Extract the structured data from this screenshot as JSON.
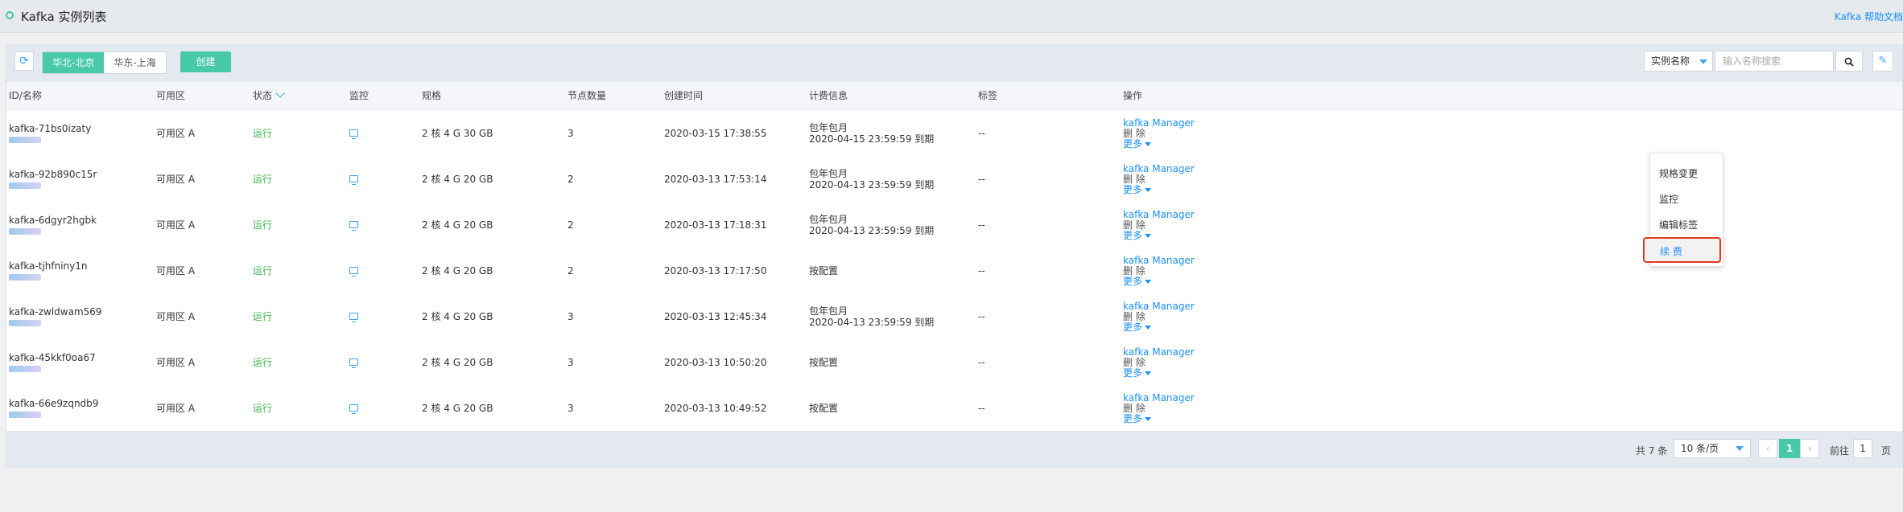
{
  "page": {
    "title": "Kafka 实例列表",
    "help_link": "Kafka 帮助文档"
  },
  "toolbar": {
    "regions": [
      "华北-北京",
      "华东-上海"
    ],
    "active_region": "华北-北京",
    "create_label": "创建",
    "search_field": "实例名称",
    "search_placeholder": "输入名称搜索"
  },
  "table": {
    "columns": [
      "ID/名称",
      "可用区",
      "状态",
      "监控",
      "规格",
      "节点数量",
      "创建时间",
      "计费信息",
      "标签",
      "操作"
    ],
    "rows": [
      {
        "id": "kafka-71bs0izaty",
        "zone": "可用区 A",
        "status": "运行",
        "spec": "2 核 4 G 30 GB",
        "nodes": "3",
        "created": "2020-03-15 17:38:55",
        "bill1": "包年包月",
        "bill2": "2020-04-15 23:59:59 到期",
        "tags": "--"
      },
      {
        "id": "kafka-92b890c15r",
        "zone": "可用区 A",
        "status": "运行",
        "spec": "2 核 4 G 20 GB",
        "nodes": "2",
        "created": "2020-03-13 17:53:14",
        "bill1": "包年包月",
        "bill2": "2020-04-13 23:59:59 到期",
        "tags": "--"
      },
      {
        "id": "kafka-6dgyr2hgbk",
        "zone": "可用区 A",
        "status": "运行",
        "spec": "2 核 4 G 20 GB",
        "nodes": "2",
        "created": "2020-03-13 17:18:31",
        "bill1": "包年包月",
        "bill2": "2020-04-13 23:59:59 到期",
        "tags": "--"
      },
      {
        "id": "kafka-tjhfniny1n",
        "zone": "可用区 A",
        "status": "运行",
        "spec": "2 核 4 G 20 GB",
        "nodes": "2",
        "created": "2020-03-13 17:17:50",
        "bill1": "按配置",
        "bill2": "",
        "tags": "--"
      },
      {
        "id": "kafka-zwldwam569",
        "zone": "可用区 A",
        "status": "运行",
        "spec": "2 核 4 G 20 GB",
        "nodes": "3",
        "created": "2020-03-13 12:45:34",
        "bill1": "包年包月",
        "bill2": "2020-04-13 23:59:59 到期",
        "tags": "--"
      },
      {
        "id": "kafka-45kkf0oa67",
        "zone": "可用区 A",
        "status": "运行",
        "spec": "2 核 4 G 20 GB",
        "nodes": "3",
        "created": "2020-03-13 10:50:20",
        "bill1": "按配置",
        "bill2": "",
        "tags": "--"
      },
      {
        "id": "kafka-66e9zqndb9",
        "zone": "可用区 A",
        "status": "运行",
        "spec": "2 核 4 G 20 GB",
        "nodes": "3",
        "created": "2020-03-13 10:49:52",
        "bill1": "按配置",
        "bill2": "",
        "tags": "--"
      }
    ],
    "op_manager": "kafka Manager",
    "op_delete": "删 除",
    "op_more": "更多"
  },
  "dropdown": {
    "items": [
      "规格变更",
      "监控",
      "编辑标签",
      "续 费"
    ]
  },
  "footer": {
    "total": "共 7 条",
    "page_size": "10 条/页",
    "current_page": "1",
    "goto_label": "前往",
    "goto_value": "1",
    "page_unit": "页"
  },
  "colors": {
    "accent": "#48c9a9",
    "link": "#1890ff",
    "status_running": "#3cb54a",
    "highlight_border": "#e03a1e"
  }
}
